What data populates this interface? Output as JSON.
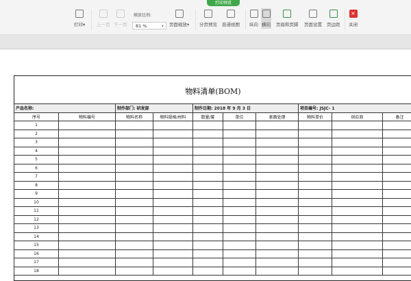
{
  "toolbar": {
    "badge": "打印预览",
    "print": "打印",
    "prev": "上一页",
    "next": "下一页",
    "zoom_label": "缩放比例:",
    "zoom_value": "81 %",
    "page_zoom": "页面缩放",
    "page_break": "分页预览",
    "normal_view": "普通视图",
    "portrait": "纵向",
    "landscape": "横向",
    "header_footer": "页眉和页脚",
    "page_setup": "页面设置",
    "margins": "页边距",
    "close": "关闭",
    "close_glyph": "×"
  },
  "sheet": {
    "title": "物料清单(BOM)",
    "info": {
      "product": "产品名称:",
      "dept": "制作部门: 研发部",
      "date": "制作日期:   2018 年  9 月  3 日",
      "project": "项目编号: JSJC- 1"
    },
    "headers": [
      "序号",
      "物料编号",
      "物料名称",
      "物料规格/材料",
      "数量/套",
      "单位",
      "表面处理",
      "物料单价",
      "供应商",
      "备注"
    ],
    "rows": [
      "1",
      "2",
      "3",
      "4",
      "5",
      "6",
      "7",
      "8",
      "9",
      "10",
      "11",
      "12",
      "13",
      "14",
      "15",
      "16",
      "17",
      "18"
    ]
  }
}
